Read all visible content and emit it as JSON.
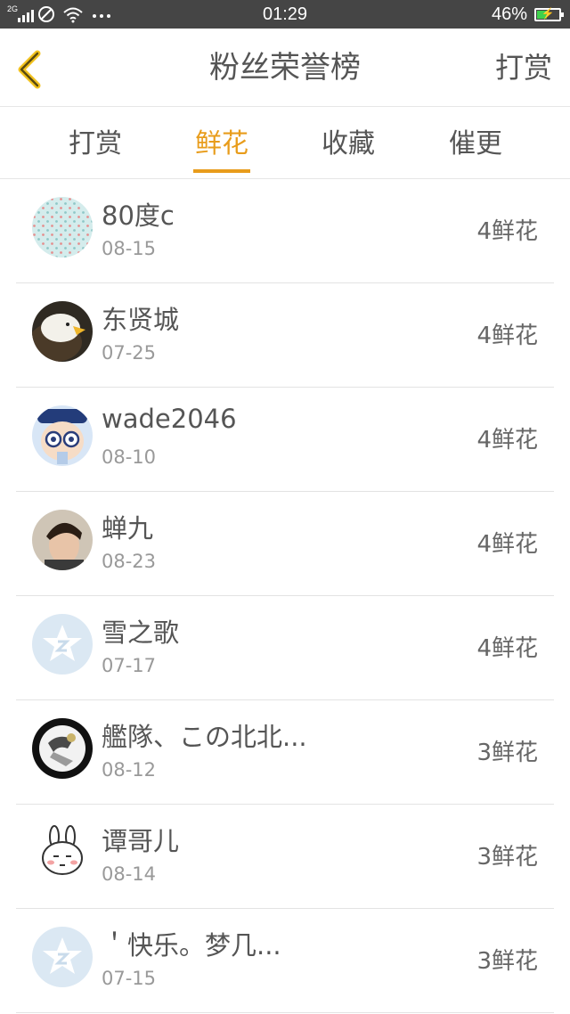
{
  "status_bar": {
    "network": "2G",
    "time": "01:29",
    "battery": "46%",
    "battery_level": 0.46,
    "icons": [
      "signal-icon",
      "no-sim-icon",
      "wifi-icon",
      "more-icon",
      "battery-charging-icon"
    ]
  },
  "header": {
    "title": "粉丝荣誉榜",
    "back_icon": "chevron-left-icon",
    "right_action": "打赏",
    "accent_color": "#e89c1b"
  },
  "tabs": [
    {
      "label": "打赏",
      "active": false
    },
    {
      "label": "鲜花",
      "active": true
    },
    {
      "label": "收藏",
      "active": false
    },
    {
      "label": "催更",
      "active": false
    }
  ],
  "list": [
    {
      "name": "80度c",
      "date": "08-15",
      "value": "4鲜花",
      "avatar": "pattern-avatar"
    },
    {
      "name": "东贤城",
      "date": "07-25",
      "value": "4鲜花",
      "avatar": "eagle-avatar"
    },
    {
      "name": "wade2046",
      "date": "08-10",
      "value": "4鲜花",
      "avatar": "cartoon-detective-avatar"
    },
    {
      "name": "蝉九",
      "date": "08-23",
      "value": "4鲜花",
      "avatar": "person-photo-avatar"
    },
    {
      "name": "雪之歌",
      "date": "07-17",
      "value": "4鲜花",
      "avatar": "default-star-avatar"
    },
    {
      "name": "艦隊、この北北...",
      "date": "08-12",
      "value": "3鲜花",
      "avatar": "anime-figure-avatar"
    },
    {
      "name": "谭哥儿",
      "date": "08-14",
      "value": "3鲜花",
      "avatar": "rabbit-sticker-avatar"
    },
    {
      "name": "＇快乐。梦几...",
      "date": "07-15",
      "value": "3鲜花",
      "avatar": "default-star-avatar"
    }
  ]
}
